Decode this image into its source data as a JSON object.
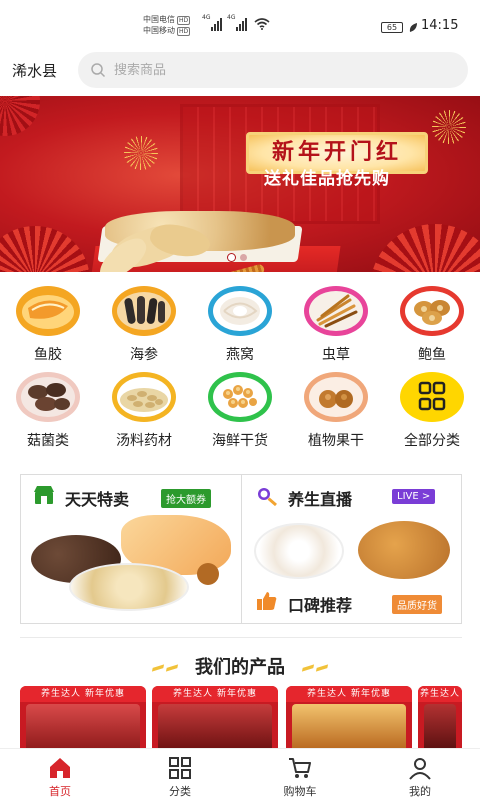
{
  "status": {
    "carrier1": "中国电信",
    "carrier2": "中国移动",
    "hd": "HD",
    "net": "4G",
    "battery": "65",
    "time": "14:15"
  },
  "header": {
    "location": "浠水县",
    "search_placeholder": "搜索商品"
  },
  "banner": {
    "headline": "新年开门红",
    "subline": "送礼佳品抢先购",
    "colors": {
      "bg": "#c4171d",
      "text": "#b4121a",
      "gold": "#f7d27a"
    }
  },
  "categories": [
    {
      "label": "鱼胶",
      "icon": "fish-maw-icon"
    },
    {
      "label": "海参",
      "icon": "sea-cucumber-icon"
    },
    {
      "label": "燕窝",
      "icon": "birds-nest-icon"
    },
    {
      "label": "虫草",
      "icon": "cordyceps-icon"
    },
    {
      "label": "鲍鱼",
      "icon": "abalone-icon"
    },
    {
      "label": "菇菌类",
      "icon": "mushroom-icon"
    },
    {
      "label": "汤料药材",
      "icon": "herbs-icon"
    },
    {
      "label": "海鲜干货",
      "icon": "dried-seafood-icon"
    },
    {
      "label": "植物果干",
      "icon": "dried-fruit-icon"
    },
    {
      "label": "全部分类",
      "icon": "grid-icon"
    }
  ],
  "promo": {
    "left_title": "天天特卖",
    "left_tag": "抢大额券",
    "right_top_title": "养生直播",
    "right_top_tag": "LIVE >",
    "right_bottom_title": "口碑推荐",
    "right_bottom_tag": "品质好货"
  },
  "products_section": {
    "title": "我们的产品",
    "card_top": "养生达人",
    "card_badge": "新年优惠"
  },
  "tabbar": {
    "items": [
      {
        "label": "首页",
        "icon": "home-icon",
        "active": true
      },
      {
        "label": "分类",
        "icon": "category-grid-icon",
        "active": false
      },
      {
        "label": "购物车",
        "icon": "cart-icon",
        "active": false
      },
      {
        "label": "我的",
        "icon": "user-icon",
        "active": false
      }
    ],
    "active_color": "#d7252b"
  }
}
